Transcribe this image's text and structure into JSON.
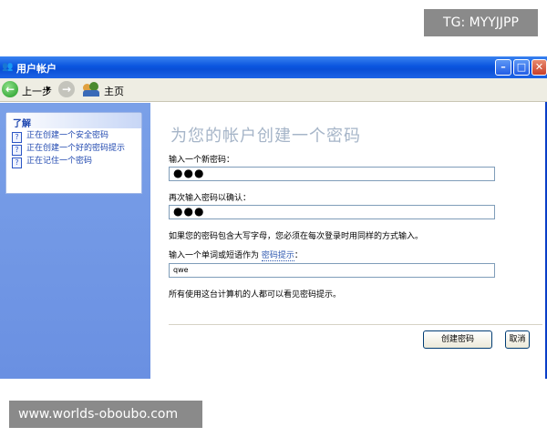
{
  "watermarks": {
    "top": "TG: MYYJJPP",
    "bottom": "www.worlds-oboubo.com"
  },
  "window": {
    "title": "用户帐户"
  },
  "toolbar": {
    "back_label": "上一步",
    "home_label": "主页"
  },
  "sidebar": {
    "learn_title": "了解",
    "items": [
      {
        "label": "正在创建一个安全密码"
      },
      {
        "label": "正在创建一个好的密码提示"
      },
      {
        "label": "正在记住一个密码"
      }
    ]
  },
  "main": {
    "heading": "为您的帐户创建一个密码",
    "new_password_label": "输入一个新密码：",
    "new_password_value": "●●●",
    "confirm_label": "再次输入密码以确认：",
    "confirm_value": "●●●",
    "case_note": "如果您的密码包含大写字母，您必须在每次登录时用同样的方式输入。",
    "hint_label": "输入一个单词或短语作为",
    "hint_link": "密码提示",
    "hint_label_end": "：",
    "hint_value": "qwe",
    "visibility_note": "所有使用这台计算机的人都可以看见密码提示。",
    "create_button": "创建密码",
    "cancel_button": "取消"
  },
  "colors": {
    "titlebar": "#0a55df",
    "sidebar": "#7aa0e8",
    "heading": "#a6b5c8",
    "link": "#2e58b0"
  }
}
